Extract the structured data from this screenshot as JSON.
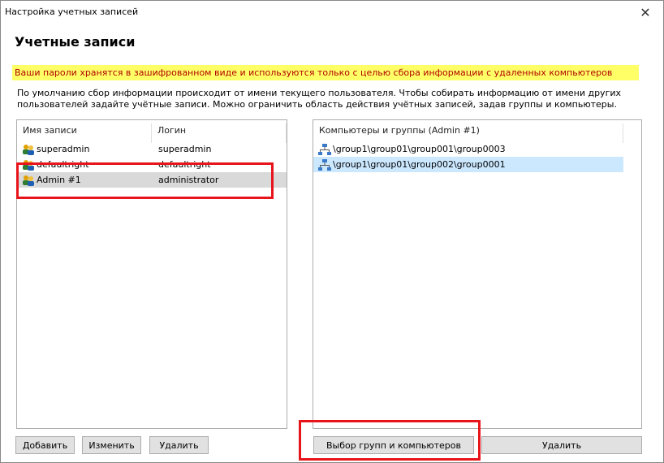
{
  "window": {
    "title": "Настройка учетных записей",
    "close_glyph": "✕"
  },
  "heading": "Учетные записи",
  "warning": "Ваши пароли хранятся в зашифрованном виде и используются только с целью сбора информации с удаленных компьютеров",
  "info": {
    "line1": "По умолчанию сбор информации происходит от имени текущего пользователя. Чтобы собирать информацию от имени других",
    "line2": "пользователей задайте учётные записи. Можно ограничить область действия учётных записей, задав группы и компьютеры."
  },
  "accounts": {
    "headers": {
      "name": "Имя записи",
      "login": "Логин"
    },
    "rows": [
      {
        "name": "superadmin",
        "login": "superadmin",
        "icon": "users-icon"
      },
      {
        "name": "defaultright",
        "login": "defaultright",
        "icon": "users-icon"
      },
      {
        "name": "Admin #1",
        "login": "administrator",
        "icon": "users-icon",
        "selected": true
      }
    ]
  },
  "groups": {
    "header": "Компьютеры и группы (Admin #1)",
    "rows": [
      {
        "path": "\\group1\\group01\\group001\\group0003",
        "icon": "network-icon"
      },
      {
        "path": "\\group1\\group01\\group002\\group0001",
        "icon": "network-icon",
        "selected": true
      }
    ]
  },
  "buttons": {
    "add": "Добавить",
    "edit": "Изменить",
    "delete_left": "Удалить",
    "select_groups": "Выбор групп и компьютеров",
    "delete_right": "Удалить"
  },
  "colors": {
    "warning_bg": "#ffff66",
    "warning_text": "#b00000",
    "highlight": "#e8141b",
    "selection_blue": "#cce8ff"
  }
}
